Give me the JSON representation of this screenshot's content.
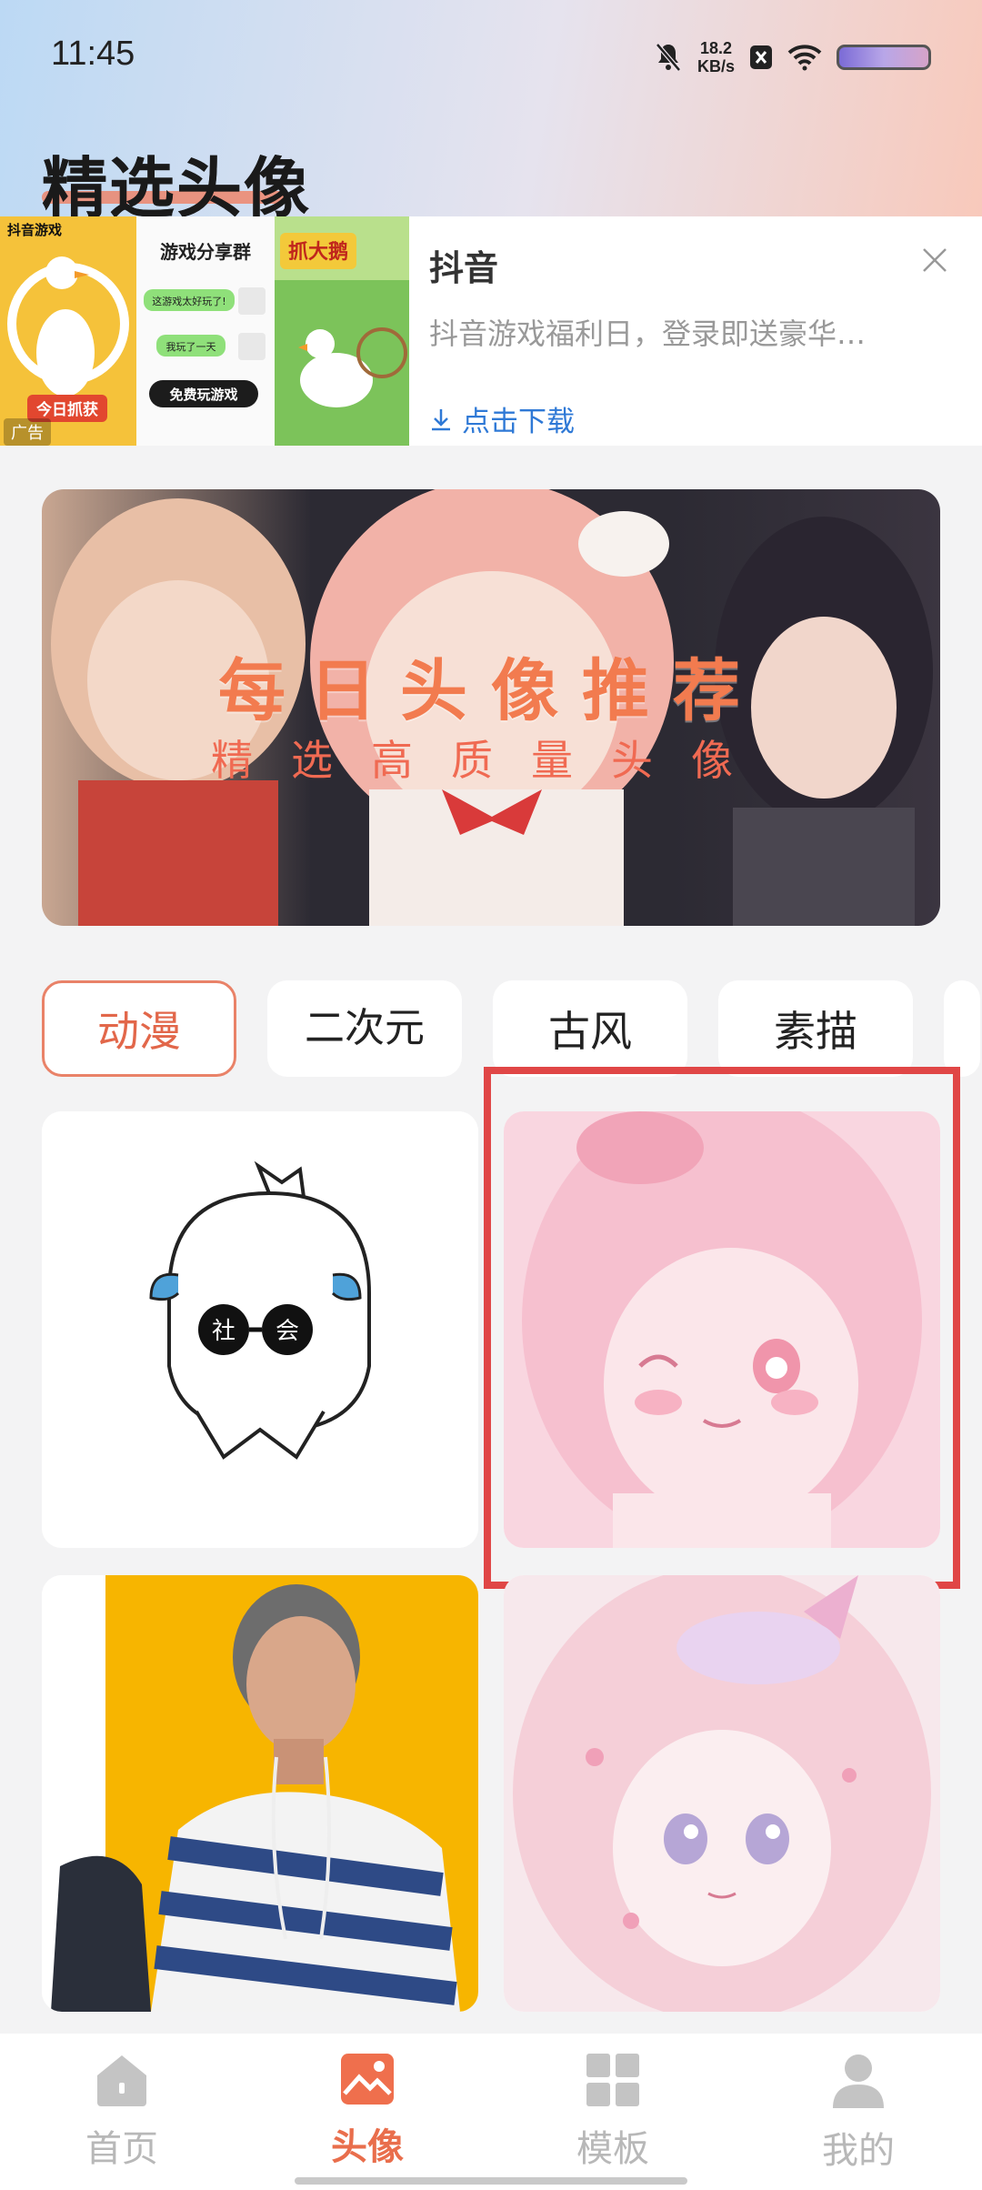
{
  "status_bar": {
    "time": "11:45",
    "net_speed_value": "18.2",
    "net_speed_unit": "KB/s"
  },
  "header": {
    "title": "精选头像"
  },
  "ad": {
    "brand": "抖音",
    "description": "抖音游戏福利日，登录即送豪华…",
    "download_label": "点击下载",
    "image_texts": {
      "app": "抖音游戏",
      "group": "游戏分享群",
      "msg1": "这游戏太好玩了!",
      "msg2": "我玩了一天",
      "cta": "免费玩游戏",
      "badge": "今日抓获",
      "game": "抓大鹅",
      "ad_tag": "广告"
    }
  },
  "banner": {
    "title": "每日头像推荐",
    "subtitle": "精选高质量头像"
  },
  "categories": {
    "items": [
      "动漫",
      "二次元",
      "古风",
      "素描"
    ],
    "active": "动漫"
  },
  "avatars": {
    "card1_text_a": "社",
    "card1_text_b": "会"
  },
  "bottom_nav": {
    "items": [
      "首页",
      "头像",
      "模板",
      "我的"
    ],
    "active": "头像"
  },
  "colors": {
    "accent": "#e96e4c",
    "highlight_box": "#e04646",
    "ad_link": "#2f79d6"
  }
}
